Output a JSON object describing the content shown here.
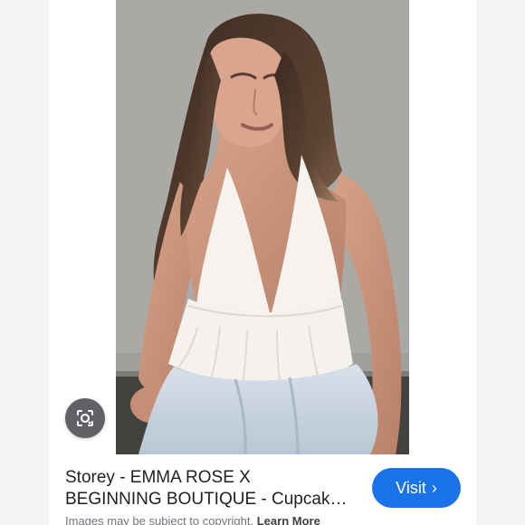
{
  "result": {
    "title_line1": "Storey - EMMA ROSE X",
    "title_line2": "BEGINNING BOUTIQUE - Cupcak…",
    "visit_label": "Visit",
    "copyright_text": "Images may be subject to copyright.",
    "learn_more_label": "Learn More"
  },
  "icons": {
    "lens": "lens-icon",
    "visit_arrow": "chevron-right-icon"
  },
  "colors": {
    "visit_button": "#1a73e8",
    "lens_button": "#5f6165",
    "wall": "#a9a9a7",
    "top": "#f4f2ec",
    "jeans": "#c9d4df"
  }
}
